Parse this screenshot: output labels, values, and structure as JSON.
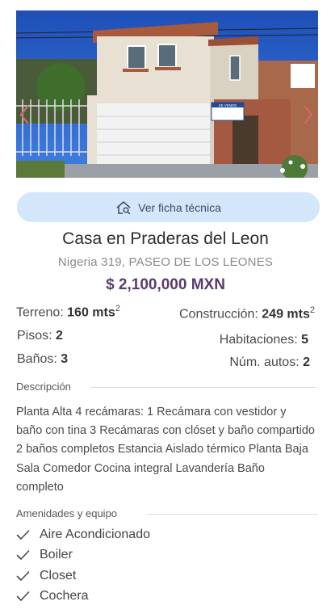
{
  "listing": {
    "photo_icon": "house-photo",
    "prev_icon": "chevron-left-icon",
    "next_icon": "chevron-right-icon",
    "ficha_button": {
      "label": "Ver ficha técnica",
      "icon": "house-search-icon"
    },
    "title": "Casa en Praderas del Leon",
    "address": "Nigeria 319, PASEO DE LOS LEONES",
    "price": "$ 2,100,000 MXN",
    "price_color": "#5a3b6b"
  },
  "specs": {
    "terreno": {
      "label": "Terreno:",
      "value": "160 mts",
      "sup": "2"
    },
    "construccion": {
      "label": "Construcción:",
      "value": "249 mts",
      "sup": "2"
    },
    "pisos": {
      "label": "Pisos:",
      "value": "2"
    },
    "habitaciones": {
      "label": "Habitaciones:",
      "value": "5"
    },
    "banos": {
      "label": "Baños:",
      "value": "3"
    },
    "autos": {
      "label": "Núm. autos:",
      "value": "2"
    }
  },
  "description": {
    "heading": "Descripción",
    "text": "Planta Alta 4 recámaras: 1 Recámara con vestidor y baño con tina 3 Recámaras con clóset y baño compartido 2 baños completos Estancia Aislado térmico Planta Baja Sala Comedor Cocina integral Lavandería Baño completo"
  },
  "amenities": {
    "heading": "Amenidades y equipo",
    "check_icon": "check-icon",
    "items": [
      "Aire Acondicionado",
      "Boiler",
      "Closet",
      "Cochera"
    ]
  },
  "sign_text": "SE VENDE"
}
